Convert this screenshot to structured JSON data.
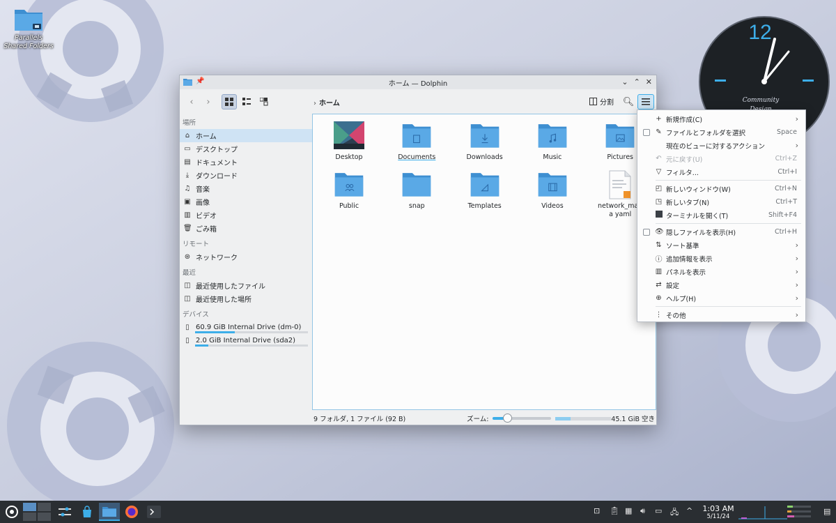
{
  "desktop": {
    "shared_folder_label": "Parallels Shared Folders",
    "clock": {
      "hour_label": "12",
      "brand_line1": "Community",
      "brand_line2": "Design"
    }
  },
  "window": {
    "title": "ホーム — Dolphin",
    "breadcrumb": "ホーム",
    "split_label": "分割",
    "sidebar": {
      "sections": [
        {
          "title": "場所",
          "items": [
            {
              "label": "ホーム",
              "icon": "home-icon",
              "selected": true
            },
            {
              "label": "デスクトップ",
              "icon": "desktop-icon"
            },
            {
              "label": "ドキュメント",
              "icon": "document-icon"
            },
            {
              "label": "ダウンロード",
              "icon": "download-icon"
            },
            {
              "label": "音楽",
              "icon": "music-icon"
            },
            {
              "label": "画像",
              "icon": "image-icon"
            },
            {
              "label": "ビデオ",
              "icon": "video-icon"
            },
            {
              "label": "ごみ箱",
              "icon": "trash-icon"
            }
          ]
        },
        {
          "title": "リモート",
          "items": [
            {
              "label": "ネットワーク",
              "icon": "network-icon"
            }
          ]
        },
        {
          "title": "最近",
          "items": [
            {
              "label": "最近使用したファイル",
              "icon": "recent-files-icon"
            },
            {
              "label": "最近使用した場所",
              "icon": "recent-places-icon"
            }
          ]
        },
        {
          "title": "デバイス",
          "items": [
            {
              "label": "60.9 GiB Internal Drive (dm-0)",
              "icon": "drive-icon",
              "usage": 0.35
            },
            {
              "label": "2.0 GiB Internal Drive (sda2)",
              "icon": "drive-icon",
              "usage": 0.12
            }
          ]
        }
      ]
    },
    "files": [
      {
        "name": "Desktop",
        "kind": "desktop"
      },
      {
        "name": "Documents",
        "kind": "documents"
      },
      {
        "name": "Downloads",
        "kind": "downloads"
      },
      {
        "name": "Music",
        "kind": "music"
      },
      {
        "name": "Pictures",
        "kind": "pictures"
      },
      {
        "name": "Public",
        "kind": "public"
      },
      {
        "name": "snap",
        "kind": "plain"
      },
      {
        "name": "Templates",
        "kind": "templates"
      },
      {
        "name": "Videos",
        "kind": "videos"
      },
      {
        "name": "network_mana yaml",
        "kind": "yaml"
      }
    ],
    "status": {
      "summary": "9 フォルダ, 1 ファイル (92 B)",
      "zoom_label": "ズーム:",
      "free_space": "45.1 GiB 空き",
      "zoom_level": 0.25,
      "disk_used": 0.27
    }
  },
  "menu": {
    "items": [
      {
        "label": "新規作成(C)",
        "icon": "plus-icon",
        "submenu": true
      },
      {
        "label": "ファイルとフォルダを選択",
        "icon": "select-icon",
        "shortcut": "Space",
        "checkbox": true
      },
      {
        "label": "現在のビューに対するアクション",
        "icon": "",
        "submenu": true
      },
      {
        "label": "元に戻す(U)",
        "icon": "undo-icon",
        "shortcut": "Ctrl+Z",
        "disabled": true
      },
      {
        "label": "フィルタ...",
        "icon": "filter-icon",
        "shortcut": "Ctrl+I"
      },
      {
        "sep": true
      },
      {
        "label": "新しいウィンドウ(W)",
        "icon": "new-window-icon",
        "shortcut": "Ctrl+N"
      },
      {
        "label": "新しいタブ(N)",
        "icon": "new-tab-icon",
        "shortcut": "Ctrl+T"
      },
      {
        "label": "ターミナルを開く(T)",
        "icon": "terminal-icon",
        "shortcut": "Shift+F4"
      },
      {
        "sep": true
      },
      {
        "label": "隠しファイルを表示(H)",
        "icon": "eye-icon",
        "shortcut": "Ctrl+H",
        "checkbox": true
      },
      {
        "label": "ソート基準",
        "icon": "sort-icon",
        "submenu": true
      },
      {
        "label": "追加情報を表示",
        "icon": "info-icon",
        "submenu": true
      },
      {
        "label": "パネルを表示",
        "icon": "panel-icon",
        "submenu": true
      },
      {
        "label": "設定",
        "icon": "settings-icon",
        "submenu": true
      },
      {
        "label": "ヘルプ(H)",
        "icon": "help-icon",
        "submenu": true
      },
      {
        "sep": true
      },
      {
        "label": "その他",
        "icon": "more-icon",
        "submenu": true
      }
    ]
  },
  "taskbar": {
    "time": "1:03 AM",
    "date": "5/11/24"
  },
  "colors": {
    "accent": "#3daee9",
    "folder": "#5aa9e6",
    "folder_dark": "#3e8fd1",
    "taskbar": "#2a2e32"
  }
}
